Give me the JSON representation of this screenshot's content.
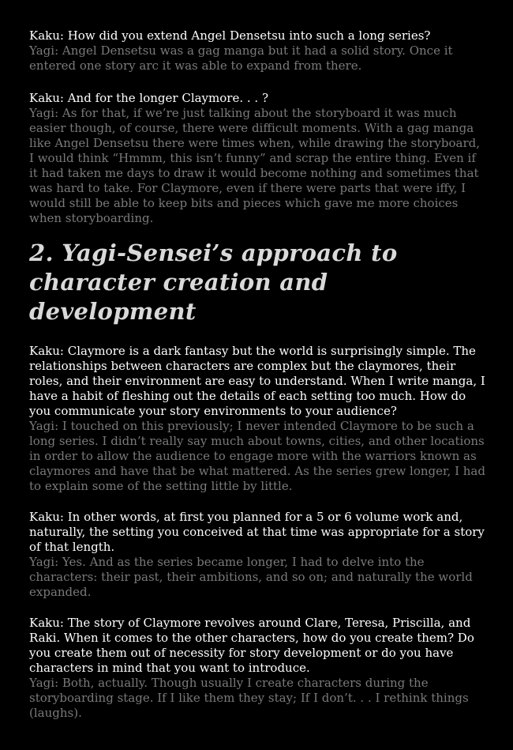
{
  "blocks": [
    {
      "question": "Kaku: How did you extend Angel Densetsu into such a long series?",
      "answer": "Yagi: Angel Densetsu was a gag manga but it had a solid story. Once it entered one story arc it was able to expand from there."
    },
    {
      "question": "Kaku: And for the longer Claymore. . . ?",
      "answer": "Yagi: As for that, if we’re just talking about the storyboard it was much easier though, of course, there were difficult moments. With a gag manga like Angel Densetsu there were times when, while drawing the storyboard, I would think “Hmmm, this isn’t funny” and scrap the entire thing.  Even if it had taken me days to draw it would become nothing and sometimes that was hard to take. For Claymore, even if there were parts that were iffy, I would still be able to keep bits and pieces which gave me more choices when storyboarding."
    }
  ],
  "section_heading": "2. Yagi-Sensei’s approach to character creation and development",
  "section_blocks": [
    {
      "question": "Kaku: Claymore is a dark fantasy but the world is surprisingly simple. The relationships between characters are complex but the claymores, their roles, and their environment are easy to understand. When I write manga, I have a habit of fleshing out the details of each setting too much. How do you communicate your story environments to your audience?",
      "answer": "Yagi: I touched on this previously; I never intended Claymore to be such a long series. I didn’t really say much about towns, cities, and other locations in order to allow the audience to engage more with the warriors known as claymores and have that be what mattered. As the series grew longer, I had to explain some of the setting little by little."
    },
    {
      "question": "Kaku: In other words, at first you planned for a 5 or 6 volume work and, naturally, the setting you conceived at that time was appropriate for a story of that length.",
      "answer": "Yagi: Yes. And as the series became longer, I had to delve into the characters: their past, their ambitions, and so on; and naturally the world expanded."
    },
    {
      "question": "Kaku: The story of Claymore revolves around Clare, Teresa, Priscilla, and Raki. When it comes to the other characters, how do you create them? Do you create them out of necessity for story development or do you have characters in mind that you want to introduce.",
      "answer": "Yagi: Both, actually. Though usually I create characters during the storyboarding stage. If I like them they stay; If I don’t. . . I rethink things (laughs)."
    }
  ]
}
